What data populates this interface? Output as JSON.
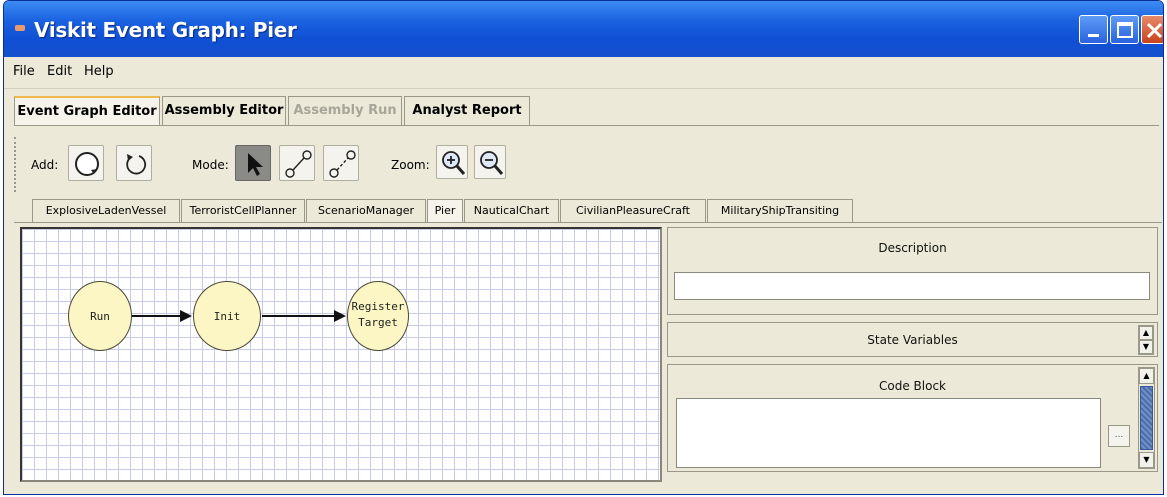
{
  "window": {
    "title": "Viskit Event Graph: Pier"
  },
  "menu": {
    "file": "File",
    "edit": "Edit",
    "help": "Help"
  },
  "main_tabs": [
    "Event Graph Editor",
    "Assembly Editor",
    "Assembly Run",
    "Analyst Report"
  ],
  "main_tab_states": [
    "active",
    "normal",
    "disabled",
    "normal"
  ],
  "toolbar": {
    "add_label": "Add:",
    "mode_label": "Mode:",
    "zoom_label": "Zoom:"
  },
  "toolbar_icons": [
    "add-event-node-icon",
    "add-self-reference-edge-icon",
    "select-mode-arrow-icon",
    "scheduling-edge-mode-icon",
    "cancelling-edge-mode-icon",
    "zoom-in-icon",
    "zoom-out-icon"
  ],
  "event_graph_tabs": [
    "ExplosiveLadenVessel",
    "TerroristCellPlanner",
    "ScenarioManager",
    "Pier",
    "NauticalChart",
    "CivilianPleasureCraft",
    "MilitaryShipTransiting"
  ],
  "active_event_graph_tab": "Pier",
  "graph": {
    "nodes": [
      {
        "label": "Run"
      },
      {
        "label": "Init"
      },
      {
        "label_line1": "Register",
        "label_line2": "Target"
      }
    ]
  },
  "panel": {
    "description_title": "Description",
    "description_value": "",
    "state_variables_title": "State Variables",
    "code_block_title": "Code Block",
    "code_block_value": "",
    "ellipsis_label": "..."
  },
  "colors": {
    "title_bar": "#1a62e0",
    "node_fill": "#fbf6c4",
    "grid": "#c8cbe8",
    "active_tab_accent": "#f0b84a"
  }
}
